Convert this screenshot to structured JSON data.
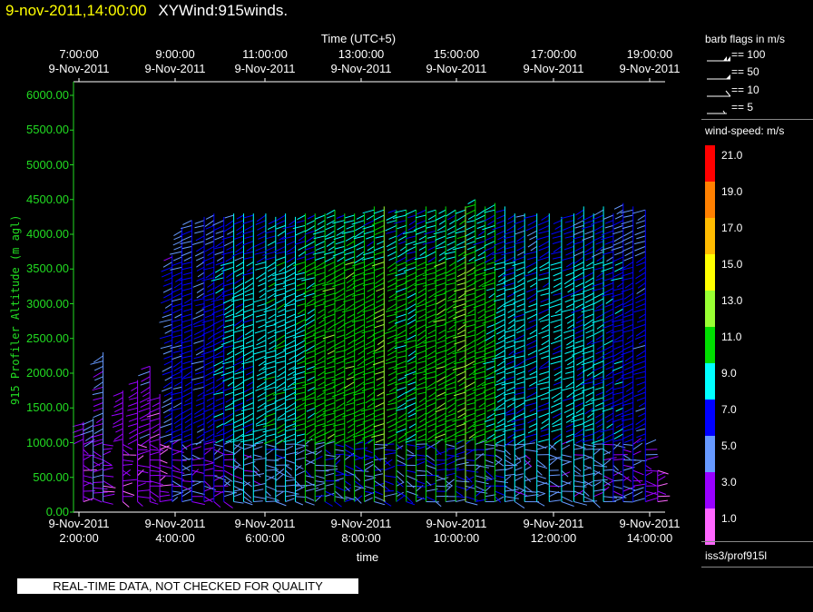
{
  "header": {
    "datetime": "9-nov-2011,14:00:00",
    "dataset": "XYWind:915winds."
  },
  "chart_data": {
    "type": "wind-barb-time-height",
    "x_top_title": "Time (UTC+5)",
    "x_bottom_title": "time",
    "ylabel": "915 Profiler Altitude (m agl)",
    "top_ticks": [
      {
        "time": "7:00:00",
        "date": "9-Nov-2011"
      },
      {
        "time": "9:00:00",
        "date": "9-Nov-2011"
      },
      {
        "time": "11:00:00",
        "date": "9-Nov-2011"
      },
      {
        "time": "13:00:00",
        "date": "9-Nov-2011"
      },
      {
        "time": "15:00:00",
        "date": "9-Nov-2011"
      },
      {
        "time": "17:00:00",
        "date": "9-Nov-2011"
      },
      {
        "time": "19:00:00",
        "date": "9-Nov-2011"
      }
    ],
    "bottom_ticks": [
      {
        "date": "9-Nov-2011",
        "time": "2:00:00"
      },
      {
        "date": "9-Nov-2011",
        "time": "4:00:00"
      },
      {
        "date": "9-Nov-2011",
        "time": "6:00:00"
      },
      {
        "date": "9-Nov-2011",
        "time": "8:00:00"
      },
      {
        "date": "9-Nov-2011",
        "time": "10:00:00"
      },
      {
        "date": "9-Nov-2011",
        "time": "12:00:00"
      },
      {
        "date": "9-Nov-2011",
        "time": "14:00:00"
      }
    ],
    "y_ticks": [
      "6000.00",
      "5500.00",
      "5000.00",
      "4500.00",
      "4000.00",
      "3500.00",
      "3000.00",
      "2500.00",
      "2000.00",
      "1500.00",
      "1000.00",
      "500.00",
      "0.00"
    ],
    "ylim": [
      0,
      6000
    ],
    "xlim_hours": [
      2,
      14
    ],
    "profiles": [
      {
        "t": 2.2,
        "base": 150,
        "top": 1300,
        "speed": 3.5
      },
      {
        "t": 2.4,
        "base": 200,
        "top": 1350,
        "speed": 4.5
      },
      {
        "t": 2.6,
        "base": 150,
        "top": 2300,
        "speed": 4
      },
      {
        "t": 3.0,
        "base": 150,
        "top": 1750,
        "speed": 3
      },
      {
        "t": 3.3,
        "base": 150,
        "top": 1900,
        "speed": 3
      },
      {
        "t": 3.55,
        "base": 150,
        "top": 2100,
        "speed": 3.5
      },
      {
        "t": 3.75,
        "base": 150,
        "top": 1700,
        "speed": 2.5
      },
      {
        "t": 4.0,
        "base": 150,
        "top": 3700,
        "speed": 6
      },
      {
        "t": 4.2,
        "base": 150,
        "top": 4100,
        "speed": 6.5
      },
      {
        "t": 4.4,
        "base": 150,
        "top": 4200,
        "speed": 7
      },
      {
        "t": 4.65,
        "base": 150,
        "top": 4250,
        "speed": 6.5
      },
      {
        "t": 4.85,
        "base": 150,
        "top": 4300,
        "speed": 7
      },
      {
        "t": 5.05,
        "base": 150,
        "top": 4250,
        "speed": 7.5
      },
      {
        "t": 5.25,
        "base": 150,
        "top": 4300,
        "speed": 8
      },
      {
        "t": 5.45,
        "base": 150,
        "top": 4300,
        "speed": 8.5
      },
      {
        "t": 5.65,
        "base": 150,
        "top": 4300,
        "speed": 8.5
      },
      {
        "t": 5.9,
        "base": 150,
        "top": 4300,
        "speed": 9
      },
      {
        "t": 6.1,
        "base": 150,
        "top": 4250,
        "speed": 9.5
      },
      {
        "t": 6.3,
        "base": 150,
        "top": 4300,
        "speed": 9.5
      },
      {
        "t": 6.5,
        "base": 150,
        "top": 4250,
        "speed": 9
      },
      {
        "t": 6.7,
        "base": 150,
        "top": 4300,
        "speed": 10
      },
      {
        "t": 6.9,
        "base": 150,
        "top": 4300,
        "speed": 10
      },
      {
        "t": 7.1,
        "base": 150,
        "top": 4300,
        "speed": 11
      },
      {
        "t": 7.3,
        "base": 150,
        "top": 4350,
        "speed": 11.5
      },
      {
        "t": 7.5,
        "base": 150,
        "top": 4300,
        "speed": 11
      },
      {
        "t": 7.7,
        "base": 150,
        "top": 4300,
        "speed": 11.5
      },
      {
        "t": 7.9,
        "base": 150,
        "top": 4300,
        "speed": 11
      },
      {
        "t": 8.1,
        "base": 150,
        "top": 4400,
        "speed": 11
      },
      {
        "t": 8.3,
        "base": 150,
        "top": 4400,
        "speed": 12
      },
      {
        "t": 8.55,
        "base": 150,
        "top": 4350,
        "speed": 11
      },
      {
        "t": 8.75,
        "base": 150,
        "top": 4350,
        "speed": 10
      },
      {
        "t": 8.95,
        "base": 150,
        "top": 4350,
        "speed": 10
      },
      {
        "t": 9.15,
        "base": 150,
        "top": 4400,
        "speed": 11
      },
      {
        "t": 9.35,
        "base": 150,
        "top": 4350,
        "speed": 11
      },
      {
        "t": 9.55,
        "base": 150,
        "top": 4400,
        "speed": 11.5
      },
      {
        "t": 9.75,
        "base": 150,
        "top": 4350,
        "speed": 11
      },
      {
        "t": 9.95,
        "base": 150,
        "top": 4400,
        "speed": 12
      },
      {
        "t": 10.15,
        "base": 150,
        "top": 4500,
        "speed": 11.5
      },
      {
        "t": 10.35,
        "base": 150,
        "top": 4400,
        "speed": 11
      },
      {
        "t": 10.55,
        "base": 150,
        "top": 4450,
        "speed": 10
      },
      {
        "t": 10.75,
        "base": 150,
        "top": 4400,
        "speed": 9
      },
      {
        "t": 10.95,
        "base": 150,
        "top": 4300,
        "speed": 8.5
      },
      {
        "t": 11.15,
        "base": 150,
        "top": 4300,
        "speed": 8
      },
      {
        "t": 11.4,
        "base": 150,
        "top": 4300,
        "speed": 8
      },
      {
        "t": 11.65,
        "base": 150,
        "top": 4300,
        "speed": 8.5
      },
      {
        "t": 11.9,
        "base": 150,
        "top": 4250,
        "speed": 8.5
      },
      {
        "t": 12.15,
        "base": 150,
        "top": 4300,
        "speed": 8.5
      },
      {
        "t": 12.35,
        "base": 150,
        "top": 4400,
        "speed": 8
      },
      {
        "t": 12.55,
        "base": 150,
        "top": 4300,
        "speed": 8.5
      },
      {
        "t": 12.75,
        "base": 150,
        "top": 4400,
        "speed": 8
      },
      {
        "t": 12.95,
        "base": 150,
        "top": 4300,
        "speed": 7.5
      },
      {
        "t": 13.15,
        "base": 150,
        "top": 4450,
        "speed": 7.5
      },
      {
        "t": 13.35,
        "base": 150,
        "top": 4400,
        "speed": 7
      },
      {
        "t": 13.6,
        "base": 150,
        "top": 4350,
        "speed": 6.5
      },
      {
        "t": 13.85,
        "base": 150,
        "top": 600,
        "speed": 2.5
      }
    ],
    "legend_barbs": {
      "title": "barb flags in m/s",
      "entries": [
        {
          "label": "== 100",
          "symbol": "barb-100"
        },
        {
          "label": "== 50",
          "symbol": "barb-50"
        },
        {
          "label": "== 10",
          "symbol": "barb-10"
        },
        {
          "label": "== 5",
          "symbol": "barb-5"
        }
      ]
    },
    "colorbar": {
      "title": "wind-speed: m/s",
      "bins": [
        {
          "label": "21.0",
          "color": "#ff0000"
        },
        {
          "label": "19.0",
          "color": "#ff8000"
        },
        {
          "label": "17.0",
          "color": "#ffbb00"
        },
        {
          "label": "15.0",
          "color": "#ffff00"
        },
        {
          "label": "13.0",
          "color": "#99ff33"
        },
        {
          "label": "11.0",
          "color": "#00dd00"
        },
        {
          "label": "9.0",
          "color": "#00ffff"
        },
        {
          "label": "7.0",
          "color": "#0000ff"
        },
        {
          "label": "5.0",
          "color": "#6699ff"
        },
        {
          "label": "3.0",
          "color": "#9900ff"
        },
        {
          "label": "1.0",
          "color": "#ff66ff"
        }
      ]
    }
  },
  "footer": {
    "status": "REAL-TIME DATA, NOT CHECKED FOR QUALITY",
    "source": "iss3/prof915l"
  },
  "colors": {
    "background": "#000000",
    "axis_frame": "#ffffff",
    "y_axis": "#22dd22",
    "title_datetime": "#ffff00"
  }
}
